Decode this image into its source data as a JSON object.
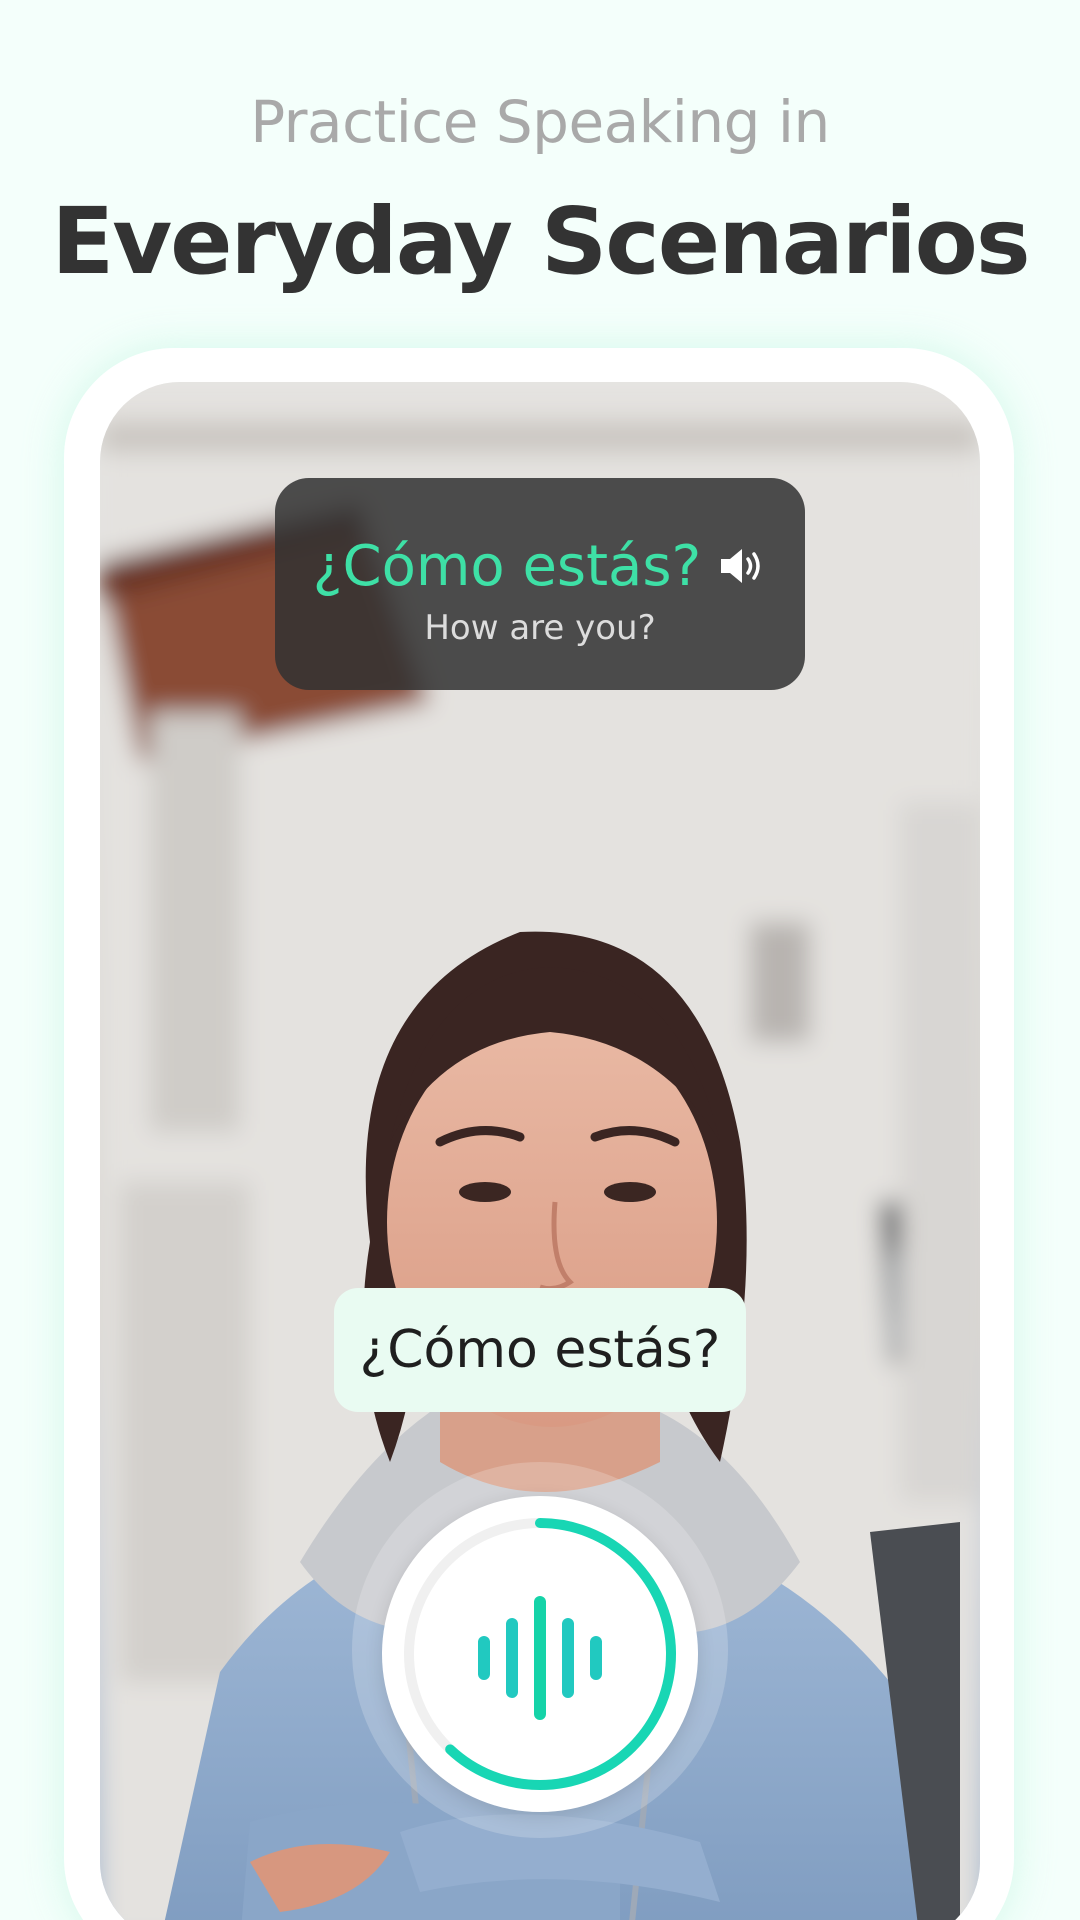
{
  "header": {
    "subtitle": "Practice Speaking in",
    "title": "Everyday Scenarios"
  },
  "lesson_card": {
    "phrase": "¿Cómo estás?",
    "translation": "How are you?",
    "phrase_color": "#3ee0a6",
    "speaker_icon": "speaker-icon"
  },
  "spoken_bubble": {
    "text": "¿Cómo estás?"
  },
  "mic": {
    "icon": "waveform-icon",
    "progress": 0.62,
    "accent_color": "#18d6b4"
  },
  "colors": {
    "background": "#f4fffb",
    "title": "#333333",
    "subtitle": "#a9a9a9"
  }
}
